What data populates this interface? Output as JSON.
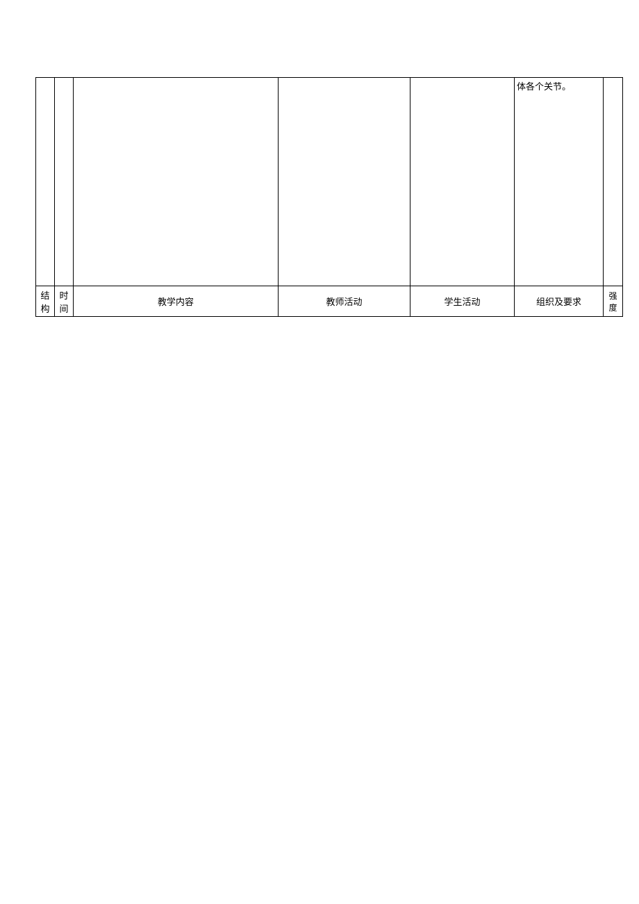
{
  "table": {
    "topRow": {
      "col1": "",
      "col2": "",
      "col3": "",
      "col4": "",
      "col5": "",
      "col6": "体各个关节。",
      "col7": ""
    },
    "headerRow": {
      "structure": "结构",
      "time": "时间",
      "content": "教学内容",
      "teacher": "教师活动",
      "student": "学生活动",
      "organize": "组织及要求",
      "intensity": "强度"
    }
  }
}
